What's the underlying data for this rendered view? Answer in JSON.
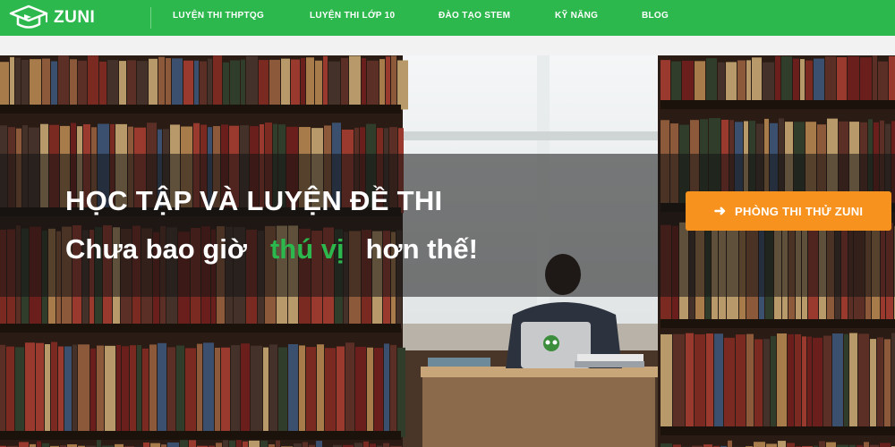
{
  "brand": {
    "name": "ZUNI",
    "color": "#2db84d",
    "logo_icon": "graduation-cap-icon"
  },
  "nav": {
    "items": [
      {
        "label": "LUYỆN THI THPTQG"
      },
      {
        "label": "LUYỆN THI LỚP 10"
      },
      {
        "label": "ĐÀO TẠO STEM"
      },
      {
        "label": "KỸ NĂNG"
      },
      {
        "label": "BLOG"
      }
    ]
  },
  "hero": {
    "headline": "HỌC TẬP VÀ LUYỆN ĐỀ THI",
    "subline_before": "Chưa bao giờ",
    "subline_highlight": "thú vị",
    "subline_after": "hơn thế!",
    "highlight_color": "#2db84d",
    "background_image": "library-student-laptop-photo",
    "cta": {
      "label": "PHÒNG THI THỬ ZUNI",
      "icon": "arrow-right-icon",
      "color": "#f7921e"
    }
  }
}
